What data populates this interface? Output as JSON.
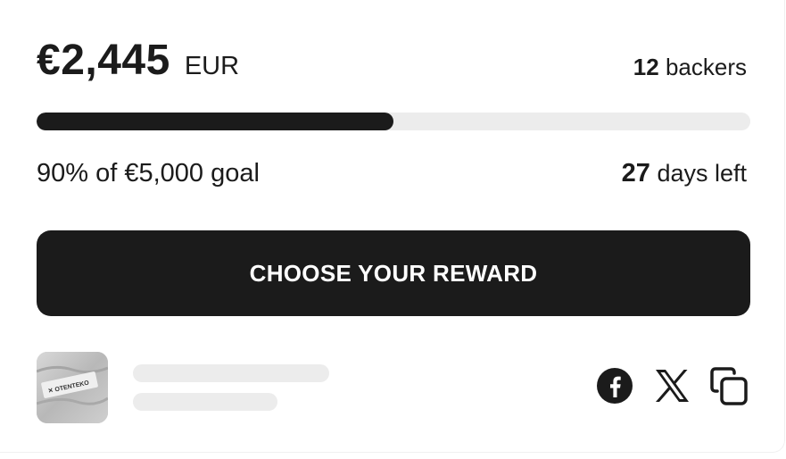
{
  "campaign": {
    "amount": "€2,445",
    "currency": "EUR",
    "backers_count": "12",
    "backers_label": "backers",
    "progress_fraction": 0.5,
    "goal_text": "90% of €5,000 goal",
    "days_count": "27",
    "days_label": "days left",
    "cta_label": "CHOOSE YOUR REWARD"
  },
  "product": {
    "thumbnail_label": "OTENTEKO"
  },
  "share": {
    "icons": [
      "facebook-icon",
      "x-icon",
      "copy-icon"
    ]
  },
  "colors": {
    "primary": "#1b1b1b",
    "track": "#ececec",
    "background": "#ffffff"
  }
}
